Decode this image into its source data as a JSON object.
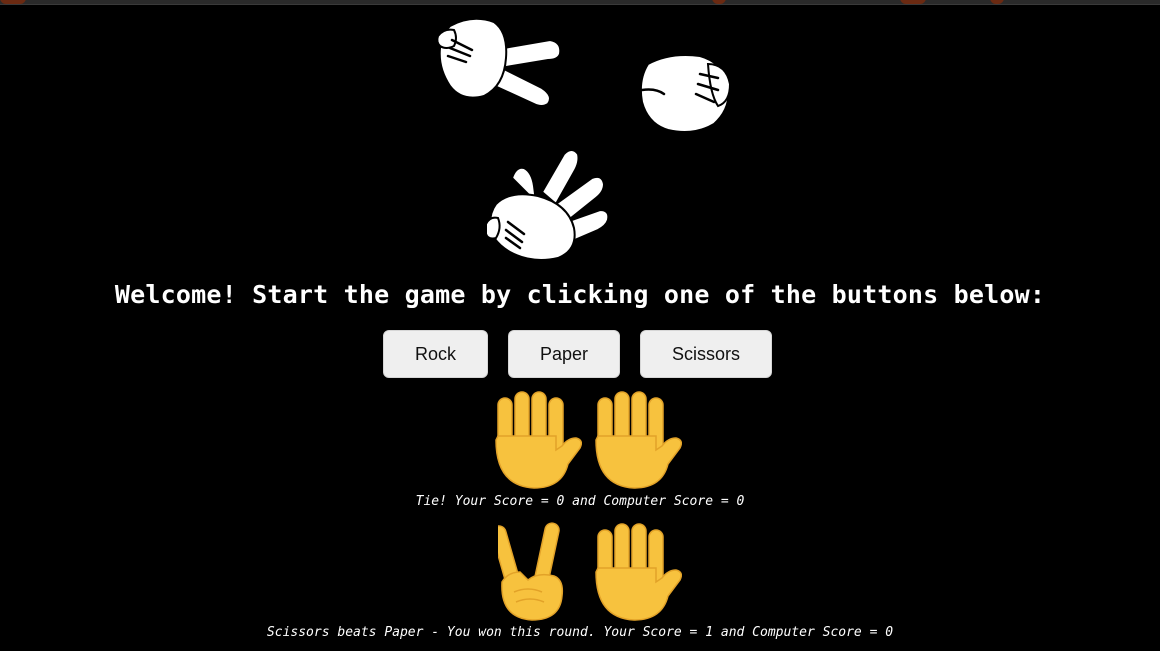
{
  "welcome_text": "Welcome! Start the game by clicking one of the buttons below:",
  "buttons": {
    "rock": "Rock",
    "paper": "Paper",
    "scissors": "Scissors"
  },
  "hero_icons": [
    "scissors-hand-icon",
    "rock-fist-icon",
    "paper-hand-icon"
  ],
  "rounds": [
    {
      "player_icon": "raised-hand-emoji",
      "computer_icon": "raised-hand-emoji",
      "result": "Tie! Your Score = 0 and Computer Score = 0"
    },
    {
      "player_icon": "victory-hand-emoji",
      "computer_icon": "raised-hand-emoji",
      "result": "Scissors beats Paper - You won this round. Your Score = 1 and Computer Score = 0"
    }
  ],
  "colors": {
    "background": "#000000",
    "text": "#ffffff",
    "button_bg": "#efefef",
    "emoji_yellow": "#f7c23e",
    "emoji_shade": "#e2a228"
  }
}
